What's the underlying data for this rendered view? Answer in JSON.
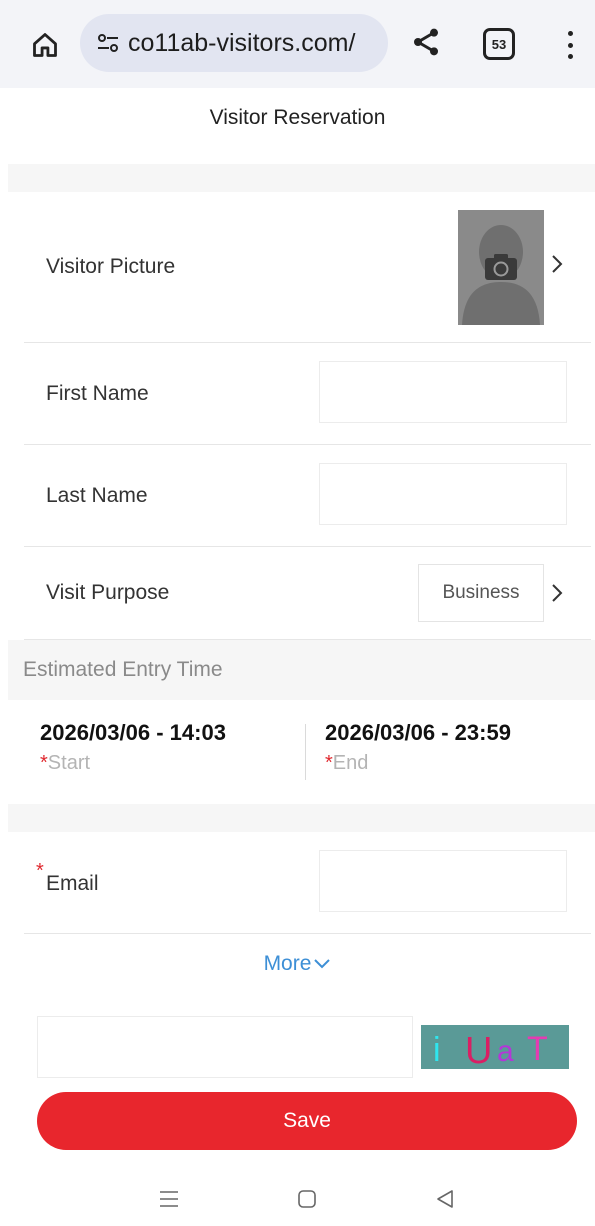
{
  "browser": {
    "url": "co11ab-visitors.com/",
    "tab_count": "53",
    "icons": [
      "home-icon",
      "site-settings-icon",
      "share-icon",
      "tab-switcher-icon",
      "more-vert-icon"
    ]
  },
  "page": {
    "title": "Visitor Reservation"
  },
  "form": {
    "visitor_picture": {
      "label": "Visitor Picture",
      "icon": "camera-icon"
    },
    "first_name": {
      "label": "First Name",
      "value": ""
    },
    "last_name": {
      "label": "Last Name",
      "value": ""
    },
    "visit_purpose": {
      "label": "Visit Purpose",
      "value": "Business"
    },
    "entry_time": {
      "section_label": "Estimated Entry Time",
      "start": {
        "value": "2026/03/06 - 14:03",
        "label": "Start",
        "required_mark": "*"
      },
      "end": {
        "value": "2026/03/06 - 23:59",
        "label": "End",
        "required_mark": "*"
      }
    },
    "email": {
      "label": "Email",
      "required_mark": "*",
      "value": ""
    },
    "more_label": "More",
    "captcha": {
      "value": "",
      "text": "i UaT"
    },
    "save_label": "Save"
  },
  "colors": {
    "accent_red": "#e8262d",
    "link_blue": "#3d8fd6",
    "required_red": "#e0282e",
    "captcha_bg": "#5a9a97"
  },
  "system_nav": {
    "icons": [
      "recents-icon",
      "home-square-icon",
      "back-triangle-icon"
    ]
  }
}
